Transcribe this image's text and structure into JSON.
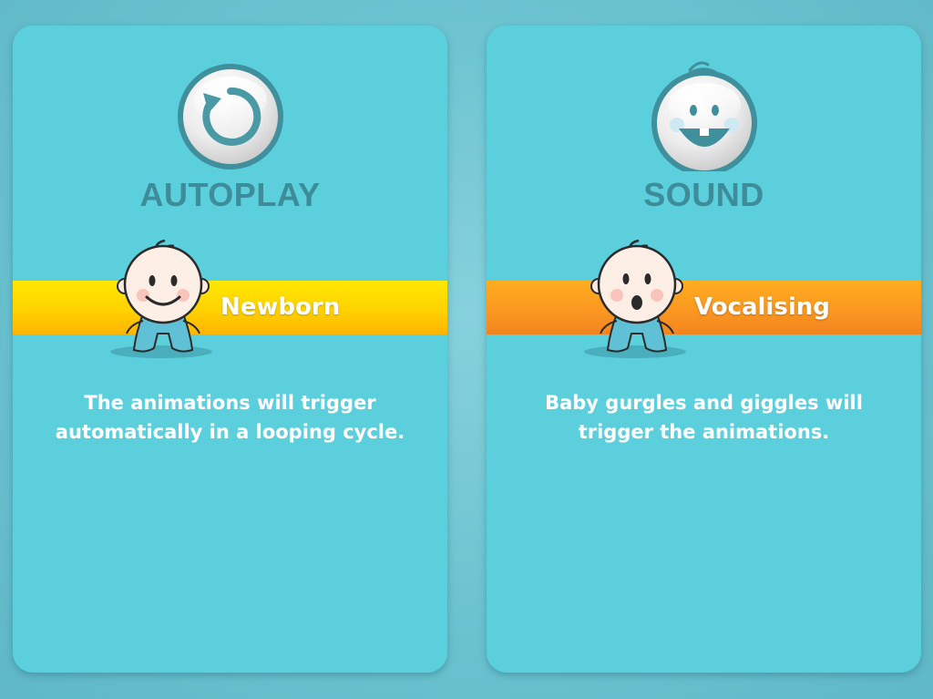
{
  "cards": [
    {
      "id": "autoplay",
      "icon": "replay-icon",
      "title": "AUTOPLAY",
      "band_label": "Newborn",
      "band_color": "#ffd200",
      "description": "The animations will trigger automatically in a looping cycle."
    },
    {
      "id": "sound",
      "icon": "laughing-baby-face-icon",
      "title": "SOUND",
      "band_label": "Vocalising",
      "band_color": "#fb9821",
      "description": "Baby gurgles and giggles will trigger the animations."
    }
  ],
  "colors": {
    "background": "#6cc3d0",
    "card": "#5ccfdc",
    "title": "#3d8c99",
    "text": "#ffffff"
  }
}
